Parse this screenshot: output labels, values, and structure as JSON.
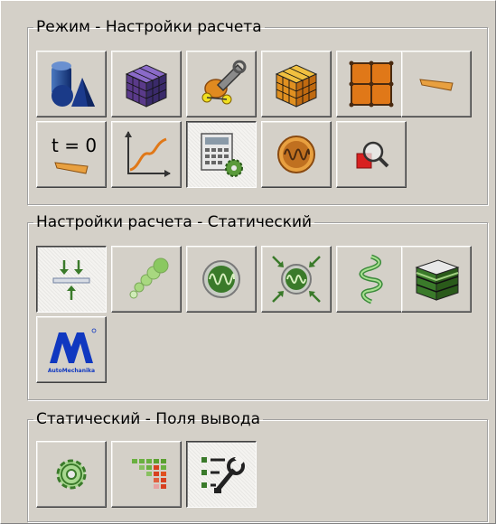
{
  "colors": {
    "panel_bg": "#d4d0c8",
    "accent_orange": "#e08020",
    "accent_green": "#4a7a3a",
    "accent_purple": "#5a3a8a",
    "accent_blue": "#1b3a8c"
  },
  "groups": [
    {
      "title": "Режим - Настройки расчета",
      "buttons": [
        {
          "icon": "solid-geometry-icon",
          "pressed": false
        },
        {
          "icon": "mesh-cube-icon",
          "pressed": false
        },
        {
          "icon": "properties-wrench-icon",
          "pressed": false
        },
        {
          "icon": "orange-mesh-cube-icon",
          "pressed": false
        },
        {
          "icon": "nodes-grid-icon",
          "pressed": false
        },
        {
          "icon": "beam-element-icon",
          "pressed": false
        },
        {
          "icon": "time-step-icon",
          "pressed": false
        },
        {
          "icon": "graph-curve-icon",
          "pressed": false
        },
        {
          "icon": "calculator-gear-icon",
          "pressed": true
        },
        {
          "icon": "oscillation-icon",
          "pressed": false
        },
        {
          "icon": "zoom-inspect-icon",
          "pressed": false
        }
      ]
    },
    {
      "title": "Настройки расчета - Статический",
      "buttons": [
        {
          "icon": "loads-supports-icon",
          "pressed": true
        },
        {
          "icon": "beads-chain-icon",
          "pressed": false
        },
        {
          "icon": "green-oscillation-icon",
          "pressed": false
        },
        {
          "icon": "oscillation-arrows-icon",
          "pressed": false
        },
        {
          "icon": "spiral-spring-icon",
          "pressed": false
        },
        {
          "icon": "green-layered-cube-icon",
          "pressed": false
        },
        {
          "icon": "automechanika-logo-icon",
          "pressed": false,
          "logo_text": "AutoMechanika"
        }
      ]
    },
    {
      "title": "Статический - Поля вывода",
      "buttons": [
        {
          "icon": "gear-settings-icon",
          "pressed": false
        },
        {
          "icon": "results-field-icon",
          "pressed": false
        },
        {
          "icon": "list-tools-icon",
          "pressed": true
        }
      ]
    }
  ]
}
